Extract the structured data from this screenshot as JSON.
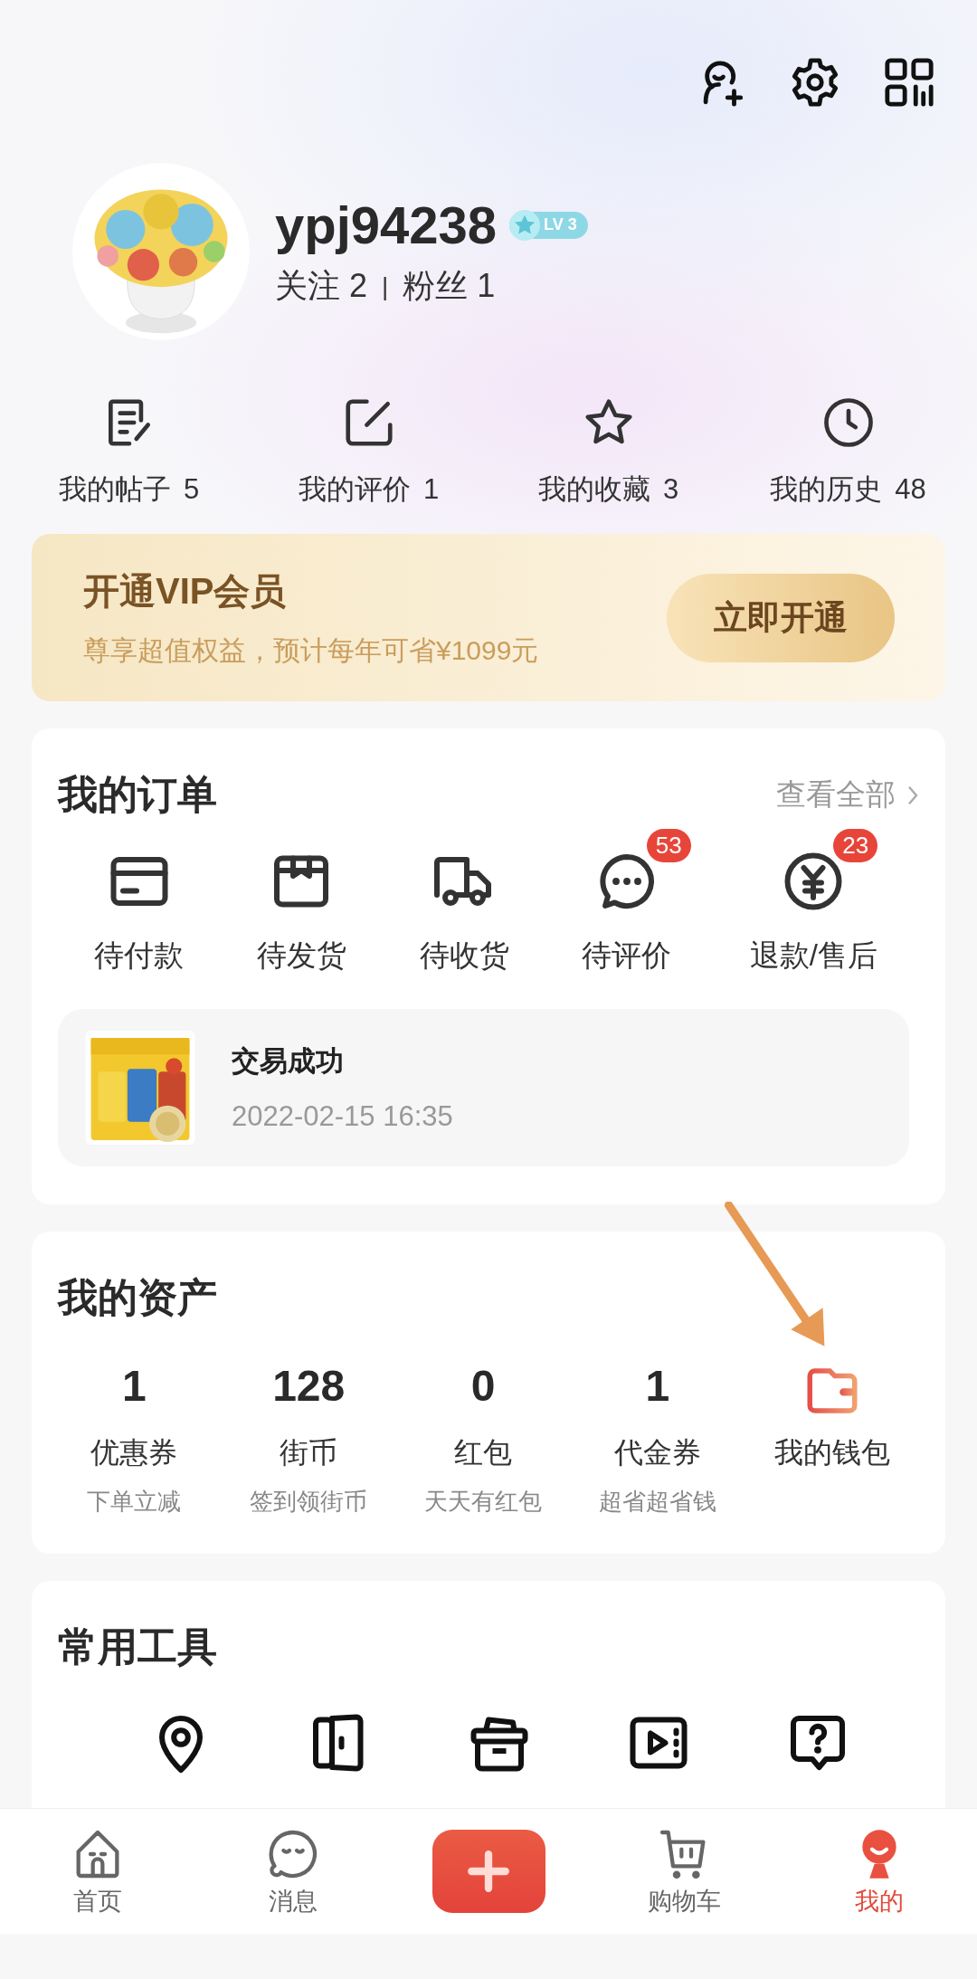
{
  "profile": {
    "username": "ypj94238",
    "level_badge": "LV 3",
    "follow_label": "关注",
    "follow_count": "2",
    "separator": "|",
    "fans_label": "粉丝",
    "fans_count": "1"
  },
  "stats": [
    {
      "kind": "posts",
      "label": "我的帖子",
      "count": "5"
    },
    {
      "kind": "reviews",
      "label": "我的评价",
      "count": "1"
    },
    {
      "kind": "favorites",
      "label": "我的收藏",
      "count": "3"
    },
    {
      "kind": "history",
      "label": "我的历史",
      "count": "48"
    }
  ],
  "vip": {
    "title": "开通VIP会员",
    "subtitle": "尊享超值权益，预计每年可省¥1099元",
    "button": "立即开通"
  },
  "orders": {
    "title": "我的订单",
    "view_all": "查看全部",
    "items": [
      {
        "kind": "pay",
        "label": "待付款"
      },
      {
        "kind": "ship",
        "label": "待发货"
      },
      {
        "kind": "receive",
        "label": "待收货"
      },
      {
        "kind": "review",
        "label": "待评价",
        "badge": "53"
      },
      {
        "kind": "refund",
        "label": "退款/售后",
        "badge": "23"
      }
    ],
    "latest": {
      "kind": "picture",
      "status": "交易成功",
      "time": "2022-02-15 16:35"
    }
  },
  "assets": {
    "title": "我的资产",
    "items": [
      {
        "kind": "number",
        "value": "1",
        "label": "优惠券",
        "sub": "下单立减"
      },
      {
        "kind": "number",
        "value": "128",
        "label": "街币",
        "sub": "签到领街币"
      },
      {
        "kind": "number",
        "value": "0",
        "label": "红包",
        "sub": "天天有红包"
      },
      {
        "kind": "number",
        "value": "1",
        "label": "代金券",
        "sub": "超省超省钱"
      },
      {
        "kind": "wallet",
        "label": "我的钱包"
      }
    ]
  },
  "tools": {
    "title": "常用工具"
  },
  "tabs": [
    {
      "kind": "home",
      "label": "首页",
      "selected": false
    },
    {
      "kind": "messages",
      "label": "消息",
      "selected": false
    },
    {
      "kind": "publish",
      "selected": false
    },
    {
      "kind": "cart",
      "label": "购物车",
      "selected": false
    },
    {
      "kind": "me",
      "label": "我的",
      "selected": true
    }
  ]
}
